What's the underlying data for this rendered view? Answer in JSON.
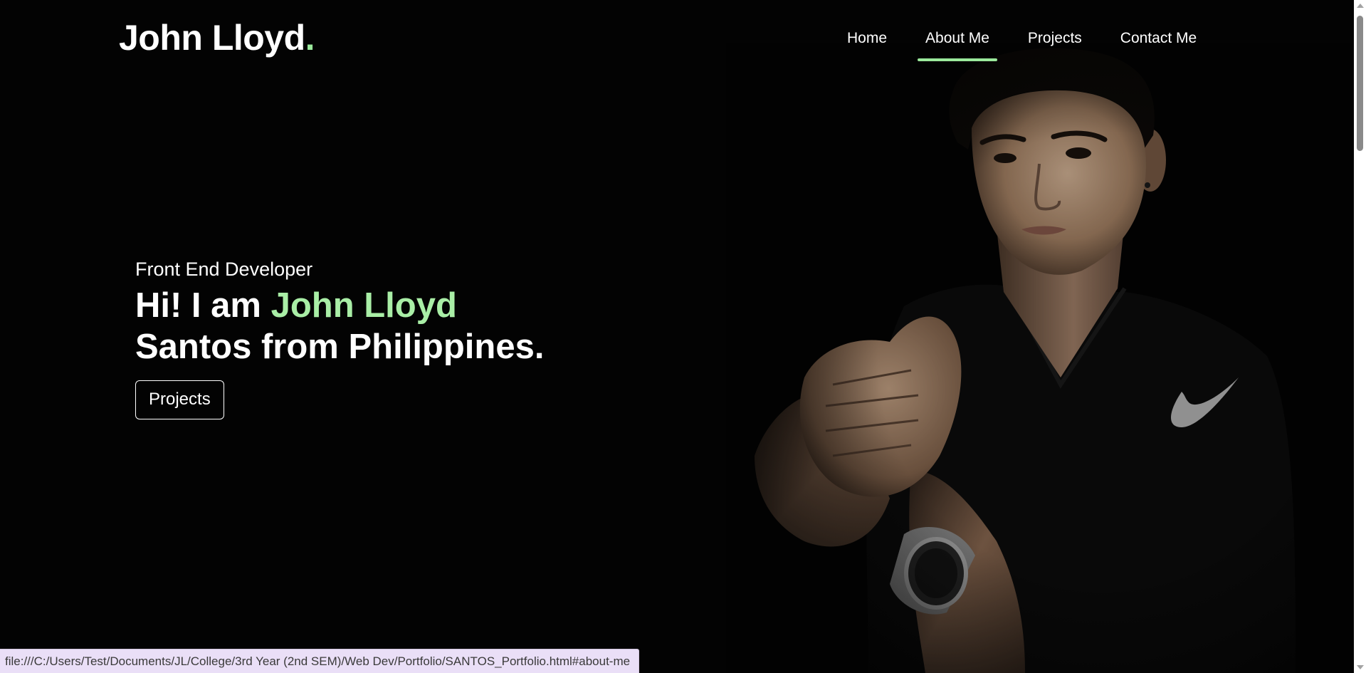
{
  "header": {
    "logo_text": "John Lloyd",
    "logo_dot": "."
  },
  "nav": {
    "items": [
      {
        "label": "Home",
        "active": false
      },
      {
        "label": "About Me",
        "active": true
      },
      {
        "label": "Projects",
        "active": false
      },
      {
        "label": "Contact Me",
        "active": false
      }
    ]
  },
  "hero": {
    "role": "Front End Developer",
    "greeting": "Hi! I am ",
    "name": "John Lloyd",
    "rest": "Santos from Philippines.",
    "button_label": "Projects"
  },
  "status_bar": {
    "url": "file:///C:/Users/Test/Documents/JL/College/3rd Year (2nd SEM)/Web Dev/Portfolio/SANTOS_Portfolio.html#about-me"
  },
  "colors": {
    "background": "#030303",
    "accent": "#9be99c",
    "text": "#ffffff",
    "status_bar_bg": "#eadff7"
  },
  "icons": {
    "brand_logo_on_shirt": "swoosh-icon"
  }
}
